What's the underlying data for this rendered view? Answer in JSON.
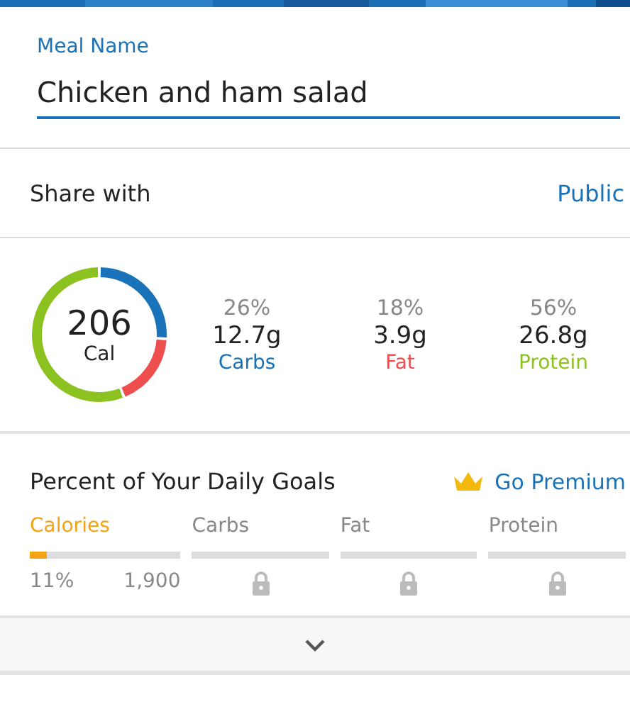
{
  "meal_name": {
    "label": "Meal Name",
    "value": "Chicken and ham salad"
  },
  "share": {
    "label": "Share with",
    "value": "Public"
  },
  "calories": {
    "value": "206",
    "unit": "Cal"
  },
  "macros": [
    {
      "percent": "26%",
      "amount": "12.7g",
      "name": "Carbs",
      "color": "#1a73b8"
    },
    {
      "percent": "18%",
      "amount": "3.9g",
      "name": "Fat",
      "color": "#ef4e4e"
    },
    {
      "percent": "56%",
      "amount": "26.8g",
      "name": "Protein",
      "color": "#8cc21f"
    }
  ],
  "goals": {
    "title": "Percent of Your Daily Goals",
    "premium": "Go Premium",
    "items": [
      {
        "name": "Calories",
        "locked": false,
        "level": 0.11,
        "percent": "11%",
        "total": "1,900"
      },
      {
        "name": "Carbs",
        "locked": true
      },
      {
        "name": "Fat",
        "locked": true
      },
      {
        "name": "Protein",
        "locked": true
      }
    ]
  },
  "expand": {
    "expanded": false
  }
}
